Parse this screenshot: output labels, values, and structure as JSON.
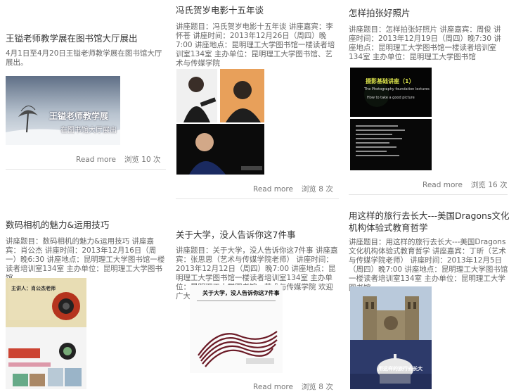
{
  "posts": [
    {
      "title": "王镒老师教学展在图书馆大厅展出",
      "desc": "4月1日至4月20日王镒老师教学展在图书馆大厅展出。",
      "image_text": [
        "王镒老师教学展",
        "在图书馆大厅展出"
      ],
      "read_more": "Read more",
      "views": "浏览 10 次"
    },
    {
      "title": "冯氏贺岁电影十五年谈",
      "desc": "讲座题目：冯氏贺岁电影十五年谈 讲座嘉宾：李怀苍 讲座时间：2013年12月26日（周四）晚7:00 讲座地点：昆明理工大学图书馆一楼读者培训室134室 主办单位：昆明理工大学图书馆、艺术与传媒学院",
      "read_more": "Read more",
      "views": "浏览 8 次"
    },
    {
      "title": "怎样拍张好照片",
      "desc": "讲座题目：怎样拍张好照片 讲座嘉宾：周俊 讲座时间：2013年12月19日（周四）晚7:30 讲座地点：昆明理工大学图书馆一楼读者培训室134室 主办单位：昆明理工大学图书馆",
      "image_text": [
        "摄影基础讲座（1）",
        "The Photography foundation lectures",
        "How to take a good picture"
      ],
      "read_more": "Read more",
      "views": "浏览 16 次"
    },
    {
      "title": "数码相机的魅力&运用技巧",
      "desc": "讲座题目：数码相机的魅力&运用技巧 讲座嘉宾：肖公杰 讲座时间：2013年12月16日（周一）晚6:30 讲座地点：昆明理工大学图书馆一楼读者培训室134室 主办单位：昆明理工大学图书馆",
      "image_text": [
        "主讲人：肖公杰老师"
      ]
    },
    {
      "title": "关于大学，没人告诉你这7件事",
      "desc": "讲座题目：关于大学，没人告诉你这7件事 讲座嘉宾：张思思（艺术与传媒学院老师） 讲座时间：2013年12月12日（周四）晚7:00 讲座地点：昆明理工大学图书馆一楼读者培训室134室 主办单位：昆明理工大学图书馆、艺术与传媒学院 欢迎广大读者朋友按时参加",
      "image_text": [
        "关于大学，没人告诉你这7件事"
      ],
      "read_more": "Read more",
      "views": "浏览 8 次"
    },
    {
      "title": "用这样的旅行去长大---美国Dragons文化机构体验式教育哲学",
      "desc": "讲座题目：用这样的旅行去长大---美国Dragons文化机构体验式教育哲学 讲座嘉宾：丁昕（艺术与传媒学院老师） 讲座时间：2013年12月5日（周四）晚7:00 讲座地点：昆明理工大学图书馆一楼读者培训室134室 主办单位：昆明理工大学图书馆",
      "image_text": [
        "用这样的旅行去长大"
      ]
    }
  ],
  "colors": {
    "link": "#777777",
    "title": "#333333",
    "desc": "#666666",
    "rule": "#e6e6e6"
  }
}
